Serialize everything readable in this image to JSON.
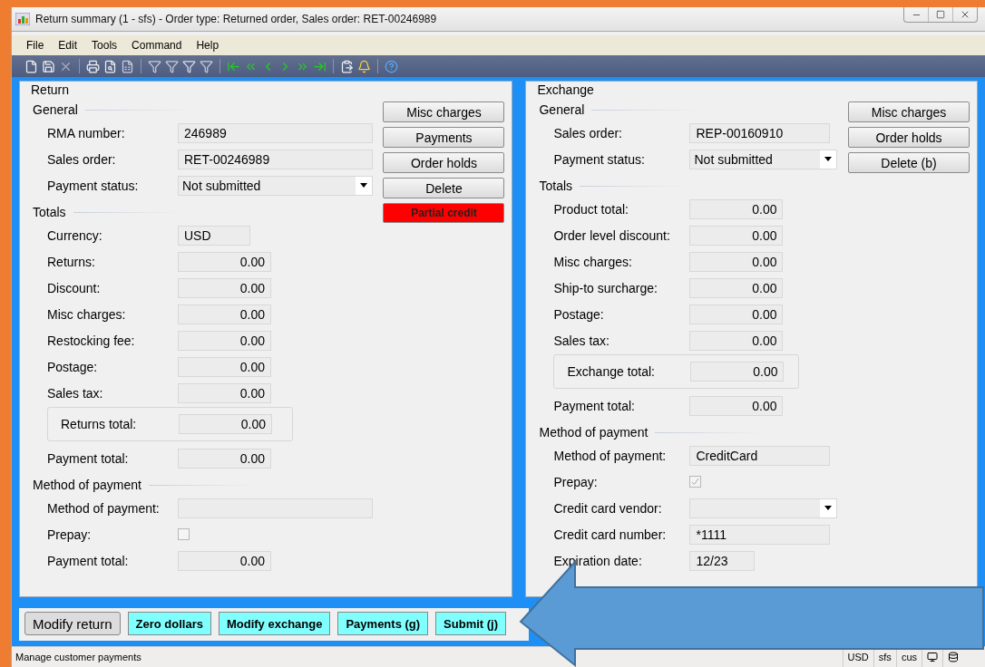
{
  "window": {
    "title": "Return summary (1 - sfs) - Order type: Returned order, Sales order: RET-00246989"
  },
  "menu": [
    "File",
    "Edit",
    "Tools",
    "Command",
    "Help"
  ],
  "return": {
    "title": "Return",
    "sections": [
      {
        "title": "General",
        "rows": [
          {
            "kind": "text",
            "label": "RMA number:",
            "value": "246989"
          },
          {
            "kind": "text",
            "label": "Sales order:",
            "value": "RET-00246989"
          },
          {
            "kind": "select",
            "label": "Payment status:",
            "value": "Not submitted"
          }
        ]
      },
      {
        "title": "Totals",
        "rows": [
          {
            "kind": "short",
            "label": "Currency:",
            "value": "USD"
          },
          {
            "kind": "amount",
            "label": "Returns:",
            "value": "0.00"
          },
          {
            "kind": "amount",
            "label": "Discount:",
            "value": "0.00"
          },
          {
            "kind": "amount",
            "label": "Misc charges:",
            "value": "0.00"
          },
          {
            "kind": "amount",
            "label": "Restocking fee:",
            "value": "0.00"
          },
          {
            "kind": "amount",
            "label": "Postage:",
            "value": "0.00"
          },
          {
            "kind": "amount",
            "label": "Sales tax:",
            "value": "0.00"
          },
          {
            "kind": "group",
            "label": "Returns total:",
            "value": "0.00"
          },
          {
            "kind": "amount",
            "label": "Payment total:",
            "value": "0.00"
          }
        ]
      },
      {
        "title": "Method of payment",
        "rows": [
          {
            "kind": "text",
            "label": "Method of payment:"
          },
          {
            "kind": "checkbox",
            "label": "Prepay:",
            "checked": false
          },
          {
            "kind": "amount",
            "label": "Payment total:",
            "value": "0.00"
          }
        ]
      }
    ],
    "buttons": [
      {
        "label": "Misc charges",
        "kind": "normal"
      },
      {
        "label": "Payments",
        "kind": "normal"
      },
      {
        "label": "Order holds",
        "kind": "normal"
      },
      {
        "label": "Delete",
        "kind": "normal"
      },
      {
        "label": "Partial credit",
        "kind": "alert"
      }
    ]
  },
  "exchange": {
    "title": "Exchange",
    "sections": [
      {
        "title": "General",
        "rows": [
          {
            "kind": "text",
            "label": "Sales order:",
            "value": "REP-00160910"
          },
          {
            "kind": "select",
            "label": "Payment status:",
            "value": "Not submitted"
          }
        ]
      },
      {
        "title": "Totals",
        "rows": [
          {
            "kind": "amount",
            "label": "Product total:",
            "value": "0.00"
          },
          {
            "kind": "amount",
            "label": "Order level discount:",
            "value": "0.00"
          },
          {
            "kind": "amount",
            "label": "Misc charges:",
            "value": "0.00"
          },
          {
            "kind": "amount",
            "label": "Ship-to surcharge:",
            "value": "0.00"
          },
          {
            "kind": "amount",
            "label": "Postage:",
            "value": "0.00"
          },
          {
            "kind": "amount",
            "label": "Sales tax:",
            "value": "0.00"
          },
          {
            "kind": "group",
            "label": "Exchange total:",
            "value": "0.00"
          },
          {
            "kind": "amount",
            "label": "Payment total:",
            "value": "0.00"
          }
        ]
      },
      {
        "title": "Method of payment",
        "rows": [
          {
            "kind": "text",
            "label": "Method of payment:",
            "value": "CreditCard"
          },
          {
            "kind": "checkbox",
            "label": "Prepay:",
            "checked": true
          },
          {
            "kind": "select",
            "label": "Credit card vendor:"
          },
          {
            "kind": "text",
            "label": "Credit card number:",
            "value": "*1111"
          },
          {
            "kind": "short",
            "label": "Expiration date:",
            "value": "12/23"
          }
        ]
      }
    ],
    "buttons": [
      {
        "label": "Misc charges",
        "kind": "normal"
      },
      {
        "label": "Order holds",
        "kind": "normal"
      },
      {
        "label": "Delete (b)",
        "kind": "normal"
      }
    ]
  },
  "actions": [
    {
      "label": "Modify return",
      "kind": "normal"
    },
    {
      "label": "Zero dollars",
      "kind": "highlight"
    },
    {
      "label": "Modify exchange",
      "kind": "highlight"
    },
    {
      "label": "Payments (g)",
      "kind": "highlight"
    },
    {
      "label": "Submit (j)",
      "kind": "highlight"
    }
  ],
  "status_bar": {
    "message": "Manage customer payments",
    "cells": [
      "USD",
      "sfs",
      "cus"
    ]
  }
}
